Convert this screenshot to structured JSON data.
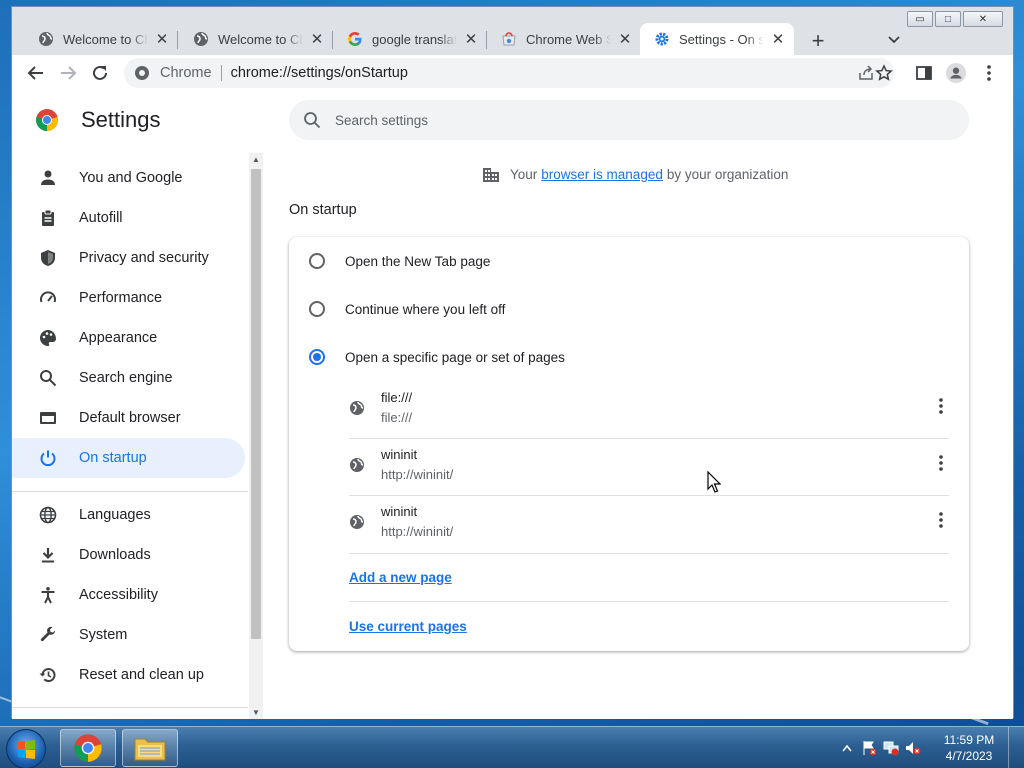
{
  "window": {
    "controls": {
      "minimize": "▭",
      "maximize": "□",
      "close": "✕"
    }
  },
  "tabs": [
    {
      "title": "Welcome to Chrome",
      "icon": "globe-icon",
      "close": "✕"
    },
    {
      "title": "Welcome to Chrome",
      "icon": "globe-icon",
      "close": "✕"
    },
    {
      "title": "google translate",
      "icon": "google-g-icon",
      "close": "✕"
    },
    {
      "title": "Chrome Web Store",
      "icon": "web-store-icon",
      "close": "✕"
    },
    {
      "title": "Settings - On startup",
      "icon": "gear-icon",
      "close": "✕",
      "active": true
    }
  ],
  "newtab_label": "+",
  "toolbar": {
    "site_label": "Chrome",
    "url": "chrome://settings/onStartup"
  },
  "settings": {
    "title": "Settings",
    "search_placeholder": "Search settings",
    "nav": [
      {
        "label": "You and Google",
        "icon": "person-icon"
      },
      {
        "label": "Autofill",
        "icon": "clipboard-icon"
      },
      {
        "label": "Privacy and security",
        "icon": "shield-icon"
      },
      {
        "label": "Performance",
        "icon": "speedometer-icon"
      },
      {
        "label": "Appearance",
        "icon": "palette-icon"
      },
      {
        "label": "Search engine",
        "icon": "search-icon"
      },
      {
        "label": "Default browser",
        "icon": "browser-window-icon"
      },
      {
        "label": "On startup",
        "icon": "power-icon",
        "active": true
      },
      {
        "label": "Languages",
        "icon": "globe-icon"
      },
      {
        "label": "Downloads",
        "icon": "download-icon"
      },
      {
        "label": "Accessibility",
        "icon": "accessibility-icon"
      },
      {
        "label": "System",
        "icon": "wrench-icon"
      },
      {
        "label": "Reset and clean up",
        "icon": "history-icon"
      }
    ],
    "managed": {
      "prefix": "Your",
      "link": "browser is managed",
      "suffix": "by your organization"
    },
    "section_title": "On startup",
    "options": [
      {
        "label": "Open the New Tab page",
        "checked": false
      },
      {
        "label": "Continue where you left off",
        "checked": false
      },
      {
        "label": "Open a specific page or set of pages",
        "checked": true
      }
    ],
    "pages": [
      {
        "title": "file:///",
        "url": "file:///"
      },
      {
        "title": "wininit",
        "url": "http://wininit/"
      },
      {
        "title": "wininit",
        "url": "http://wininit/"
      }
    ],
    "add_page": "Add a new page",
    "use_current": "Use current pages"
  },
  "taskbar": {
    "time": "11:59 PM",
    "date": "4/7/2023"
  },
  "colors": {
    "accent": "#1a73e8",
    "active_nav_bg": "#e8f0fe"
  }
}
